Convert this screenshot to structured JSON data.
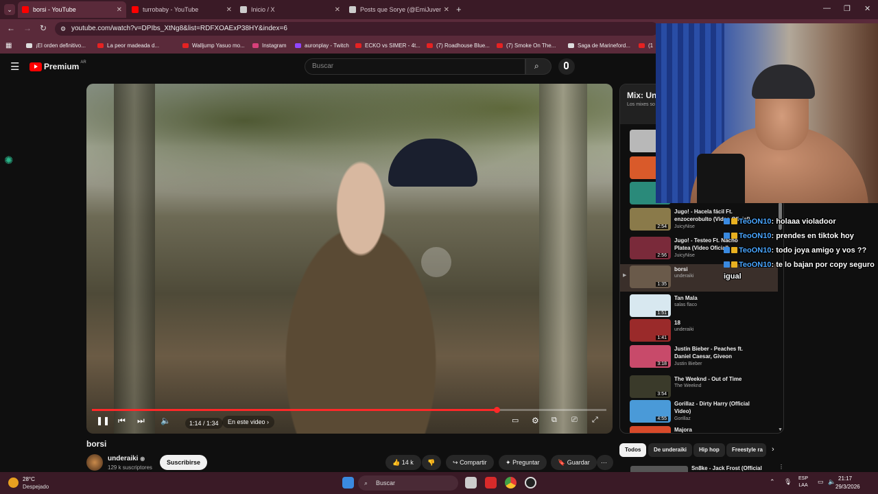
{
  "browser": {
    "tabs": [
      {
        "label": "borsi - YouTube",
        "active": true,
        "icon": "youtube-icon"
      },
      {
        "label": "turrobaby - YouTube",
        "active": false,
        "icon": "youtube-icon"
      },
      {
        "label": "Inicio / X",
        "active": false,
        "icon": "x-icon"
      },
      {
        "label": "Posts que Sorye (@EmiJuvenal)",
        "active": false,
        "icon": "x-icon"
      }
    ],
    "url": "youtube.com/watch?v=DPIbs_XtNg8&list=RDFXOAExP38HY&index=6",
    "bookmarks": [
      "¡El orden definitivo...",
      "La peor madeada d...",
      "Walljump Yasuo mo...",
      "Instagram",
      "auronplay - Twitch",
      "ECKO vs SIMER - 4t...",
      "(7) Roadhouse Blue...",
      "(7) Smoke On The...",
      "Saga de Marineford...",
      "(1"
    ]
  },
  "youtube": {
    "logo_label": "Premium",
    "region": "AR",
    "search_placeholder": "Buscar"
  },
  "player": {
    "time": "1:14 / 1:34",
    "progress": 0.787,
    "chapter_label": "En este video"
  },
  "video": {
    "title": "borsi",
    "channel": "underaiki",
    "subscribers": "129 k suscriptores",
    "subscribe_label": "Suscribirse",
    "likes": "14 k",
    "share_label": "Compartir",
    "ask_label": "Preguntar",
    "save_label": "Guardar"
  },
  "playlist": {
    "title": "Mix: Und",
    "subtitle": "Los mixes so",
    "items": [
      {
        "title": "",
        "channel": "",
        "duration": "",
        "color": "#b8b8b8"
      },
      {
        "title": "",
        "channel": "",
        "duration": "",
        "color": "#d95a2a"
      },
      {
        "title": "",
        "channel": "",
        "duration": "",
        "color": "#2a8a7a"
      },
      {
        "title": "Jugo! - Hacela fácil Ft. enzocerobulto (Video Oficial)",
        "channel": "JuicyNise",
        "duration": "2:54",
        "color": "#8a7a4a"
      },
      {
        "title": "Jugo! - Testeo Ft. Nacho Platea (Video Oficial)",
        "channel": "JuicyNise",
        "duration": "2:56",
        "color": "#7a2a3a"
      },
      {
        "title": "borsi",
        "channel": "underaiki",
        "duration": "1:35",
        "color": "#6a5a4a",
        "current": true
      },
      {
        "title": "Tan Mala",
        "channel": "salas flaco",
        "duration": "1:51",
        "color": "#d8e8f0"
      },
      {
        "title": "18",
        "channel": "underaiki",
        "duration": "1:41",
        "color": "#9a2a2a"
      },
      {
        "title": "Justin Bieber - Peaches ft. Daniel Caesar, Giveon",
        "channel": "Justin Bieber",
        "duration": "3:18",
        "color": "#c84a6a"
      },
      {
        "title": "The Weeknd - Out of Time",
        "channel": "The Weeknd",
        "duration": "3:54",
        "color": "#3a3a2a"
      },
      {
        "title": "Gorillaz - Dirty Harry (Official Video)",
        "channel": "Gorillaz",
        "duration": "4:55",
        "color": "#4a9ad8"
      },
      {
        "title": "Majora",
        "channel": "",
        "duration": "",
        "color": "#d84a2a"
      }
    ]
  },
  "chips": [
    "Todos",
    "De underaiki",
    "Hip hop",
    "Freestyle ra"
  ],
  "next_video_peek": "Sn8ke - Jack Frost (Official",
  "chat": [
    {
      "user": "TeoON10",
      "message": ": holaaa violadoor"
    },
    {
      "user": "TeoON10",
      "message": ": prendes en tiktok hoy"
    },
    {
      "user": "TeoON10",
      "message": ": todo joya amigo y vos ??"
    },
    {
      "user": "TeoON10",
      "message": ": te lo bajan por copy seguro"
    },
    {
      "user": "",
      "message": "igual"
    }
  ],
  "taskbar": {
    "temperature": "28°C",
    "weather": "Despejado",
    "search": "Buscar",
    "lang_1": "ESP",
    "lang_2": "LAA",
    "time": "21:17",
    "date": "29/3/2026"
  },
  "colors": {
    "accent": "#ff2828",
    "chrome": "#5a2a3a",
    "tabstrip": "#3a1a26"
  }
}
